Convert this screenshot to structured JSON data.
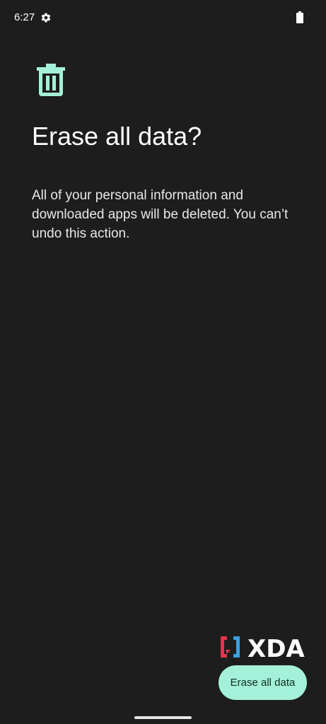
{
  "status_bar": {
    "time": "6:27",
    "icons": [
      "gear-icon",
      "battery-icon"
    ]
  },
  "main": {
    "icon": "trash-icon",
    "title": "Erase all data?",
    "description": "All of your personal information and downloaded apps will be deleted. You can’t undo this action."
  },
  "watermark": {
    "text": "XDA"
  },
  "actions": {
    "erase_label": "Erase all data"
  },
  "colors": {
    "background": "#1c1d1c",
    "accent": "#a4f0d8",
    "on_accent": "#0e2e24",
    "icon": "#a4f0d8",
    "watermark_red": "#e0354d",
    "watermark_blue": "#3aa0e0"
  }
}
